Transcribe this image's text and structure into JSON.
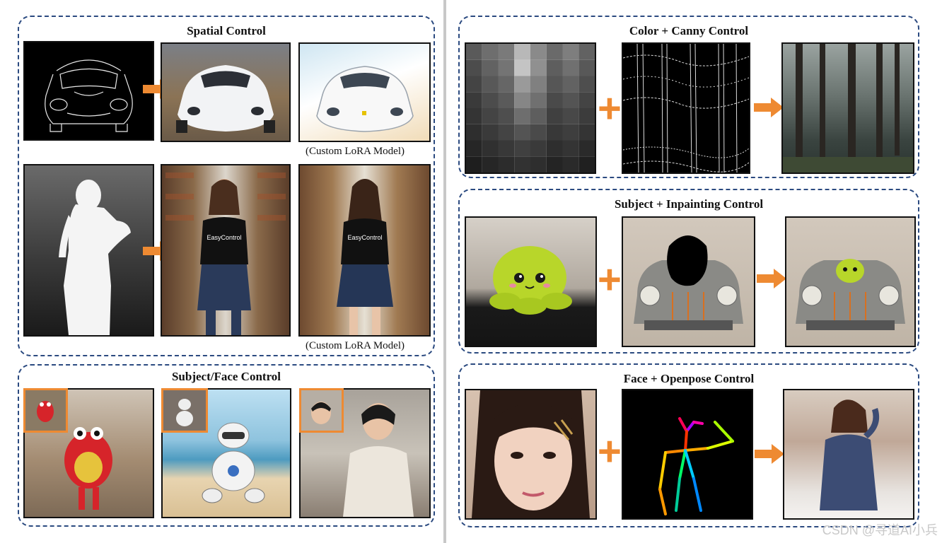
{
  "left": {
    "spatial_title": "Spatial Control",
    "caption_1": "(Custom LoRA Model)",
    "caption_2": "(Custom LoRA Model)",
    "subject_title": "Subject/Face Control",
    "shirt_text": "EasyControl"
  },
  "right": {
    "color_canny_title": "Color + Canny Control",
    "subject_inpaint_title": "Subject + Inpainting Control",
    "face_openpose_title": "Face + Openpose Control",
    "plus_symbol": "+"
  },
  "watermark": "CSDN @寻道AI小兵",
  "colors": {
    "accent": "#ee8a32",
    "panel_border": "#2b4a80"
  }
}
